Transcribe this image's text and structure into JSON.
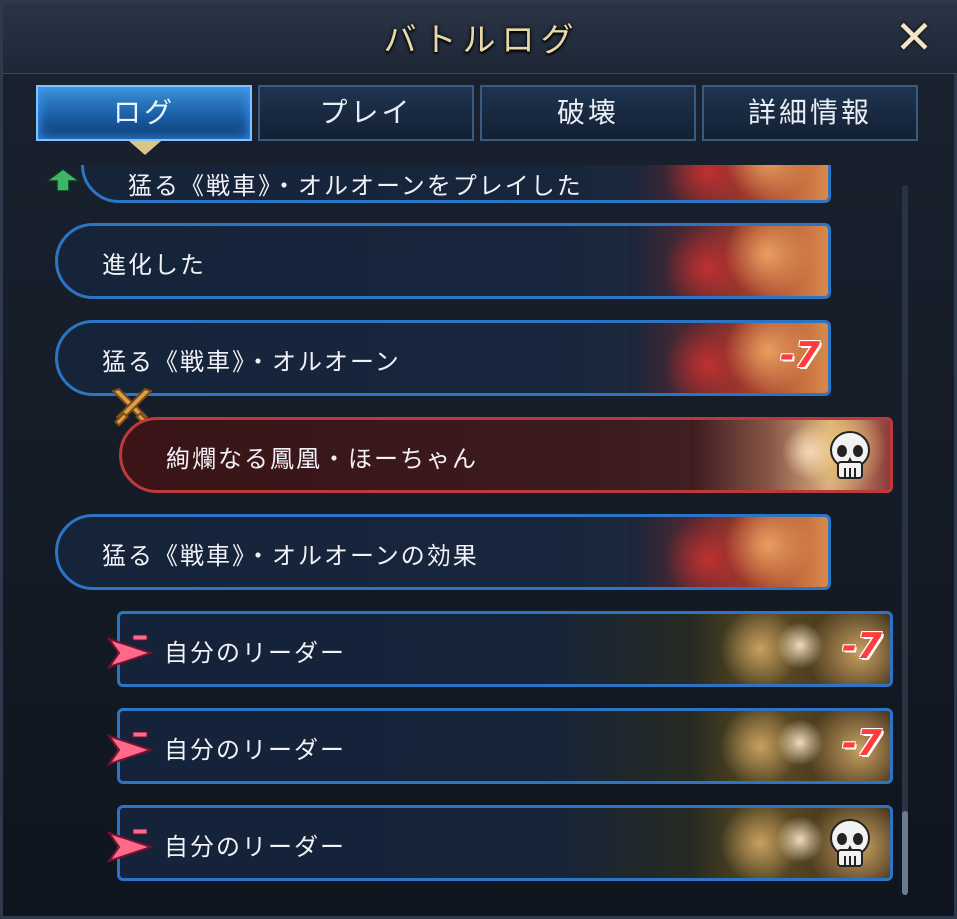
{
  "header": {
    "title": "バトルログ",
    "close_glyph": "✕"
  },
  "tabs": [
    {
      "label": "ログ",
      "active": true
    },
    {
      "label": "プレイ",
      "active": false
    },
    {
      "label": "破壊",
      "active": false
    },
    {
      "label": "詳細情報",
      "active": false
    }
  ],
  "log": {
    "partial_entry": {
      "text": "猛る《戦車》・オルオーンをプレイした",
      "icon": "evolve-up-icon"
    },
    "entries": [
      {
        "text": "進化した",
        "style": "blue",
        "portrait": "orleon"
      },
      {
        "text": "猛る《戦車》・オルオーン",
        "style": "blue",
        "portrait": "orleon",
        "value": "-7"
      },
      {
        "text": "絢爛なる鳳凰・ほーちゃん",
        "style": "red",
        "portrait": "ho",
        "icon": "skull-icon",
        "attack_icon": "crossed-swords-icon"
      },
      {
        "text": "猛る《戦車》・オルオーンの効果",
        "style": "blue",
        "portrait": "orleon"
      },
      {
        "text": "自分のリーダー",
        "style": "leader",
        "portrait": "zeta",
        "value": "-7",
        "icon": "damage-arrow-icon"
      },
      {
        "text": "自分のリーダー",
        "style": "leader",
        "portrait": "zeta",
        "value": "-7",
        "icon": "damage-arrow-icon"
      },
      {
        "text": "自分のリーダー",
        "style": "leader",
        "portrait": "zeta",
        "icon": "skull-icon",
        "arrow": "damage-arrow-icon"
      }
    ]
  },
  "colors": {
    "blue_border": "#2c74c4",
    "red_border": "#c0393a",
    "damage_text": "#ff3b3b",
    "title_text": "#e8d8a8"
  }
}
